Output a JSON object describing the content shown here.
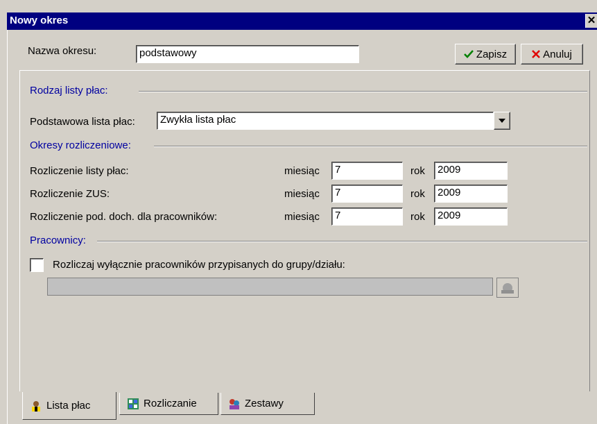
{
  "window": {
    "title": "Nowy okres",
    "close_glyph": "✕"
  },
  "name_field": {
    "label": "Nazwa okresu:",
    "value": "podstawowy"
  },
  "buttons": {
    "save": {
      "label": "Zapisz",
      "icon": "checkmark-icon"
    },
    "cancel": {
      "label": "Anuluj",
      "icon": "cross-icon"
    }
  },
  "section_payroll_type": {
    "title": "Rodzaj listy płac:",
    "base_label": "Podstawowa lista płac:",
    "base_value": "Zwykła lista płac"
  },
  "section_periods": {
    "title": "Okresy rozliczeniowe:",
    "month_label": "miesiąc",
    "year_label": "rok",
    "rows": [
      {
        "label": "Rozliczenie listy płac:",
        "month": "7",
        "year": "2009"
      },
      {
        "label": "Rozliczenie ZUS:",
        "month": "7",
        "year": "2009"
      },
      {
        "label": "Rozliczenie pod. doch. dla pracowników:",
        "month": "7",
        "year": "2009"
      }
    ]
  },
  "section_employees": {
    "title": "Pracownicy:",
    "checkbox_label": "Rozliczaj wyłącznie pracowników przypisanych do grupy/działu:",
    "checked": false,
    "group_value": ""
  },
  "tabs": [
    {
      "label": "Lista płac",
      "icon": "person-icon",
      "active": true
    },
    {
      "label": "Rozliczanie",
      "icon": "calculator-icon",
      "active": false
    },
    {
      "label": "Zestawy",
      "icon": "people-icon",
      "active": false
    }
  ],
  "colors": {
    "title_bar": "#000080",
    "section_title": "#0000a0",
    "window_bg": "#d4d0c8"
  }
}
